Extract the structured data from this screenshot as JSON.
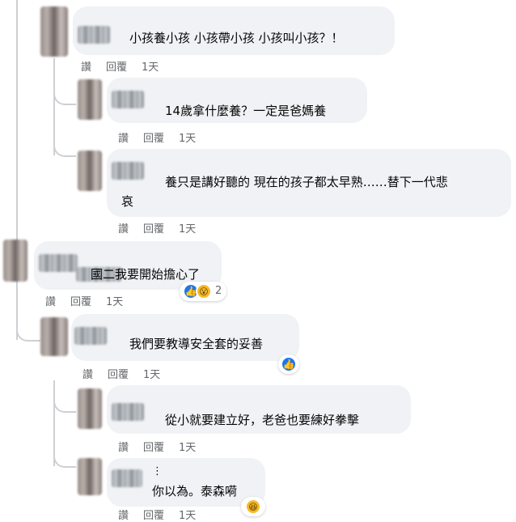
{
  "actions": {
    "like": "讚",
    "reply": "回覆",
    "time": "1天"
  },
  "comments": [
    {
      "text": "小孩養小孩 小孩帶小孩 小孩叫小孩？！"
    },
    {
      "text": "14歲拿什麼養？一定是爸媽養"
    },
    {
      "text_line1": "養只是講好聽的 現在的孩子都太早熟……替下一代悲",
      "text_line2": "哀"
    },
    {
      "text": "國二我要開始擔心了",
      "reaction_count": "2",
      "reactions": [
        "like-icon",
        "wow-icon"
      ]
    },
    {
      "text": "我們要教導安全套的妥善",
      "reactions": [
        "like-icon"
      ]
    },
    {
      "text": "從小就要建立好，老爸也要練好拳擊"
    },
    {
      "text_line1": "⋮",
      "text_line2": "你以為。泰森嗬",
      "reactions": [
        "haha-icon"
      ]
    }
  ],
  "colors": {
    "bubble": "#f0f2f5",
    "meta": "#65676b",
    "like": "#1877f2",
    "emoji": "#f7b928"
  }
}
